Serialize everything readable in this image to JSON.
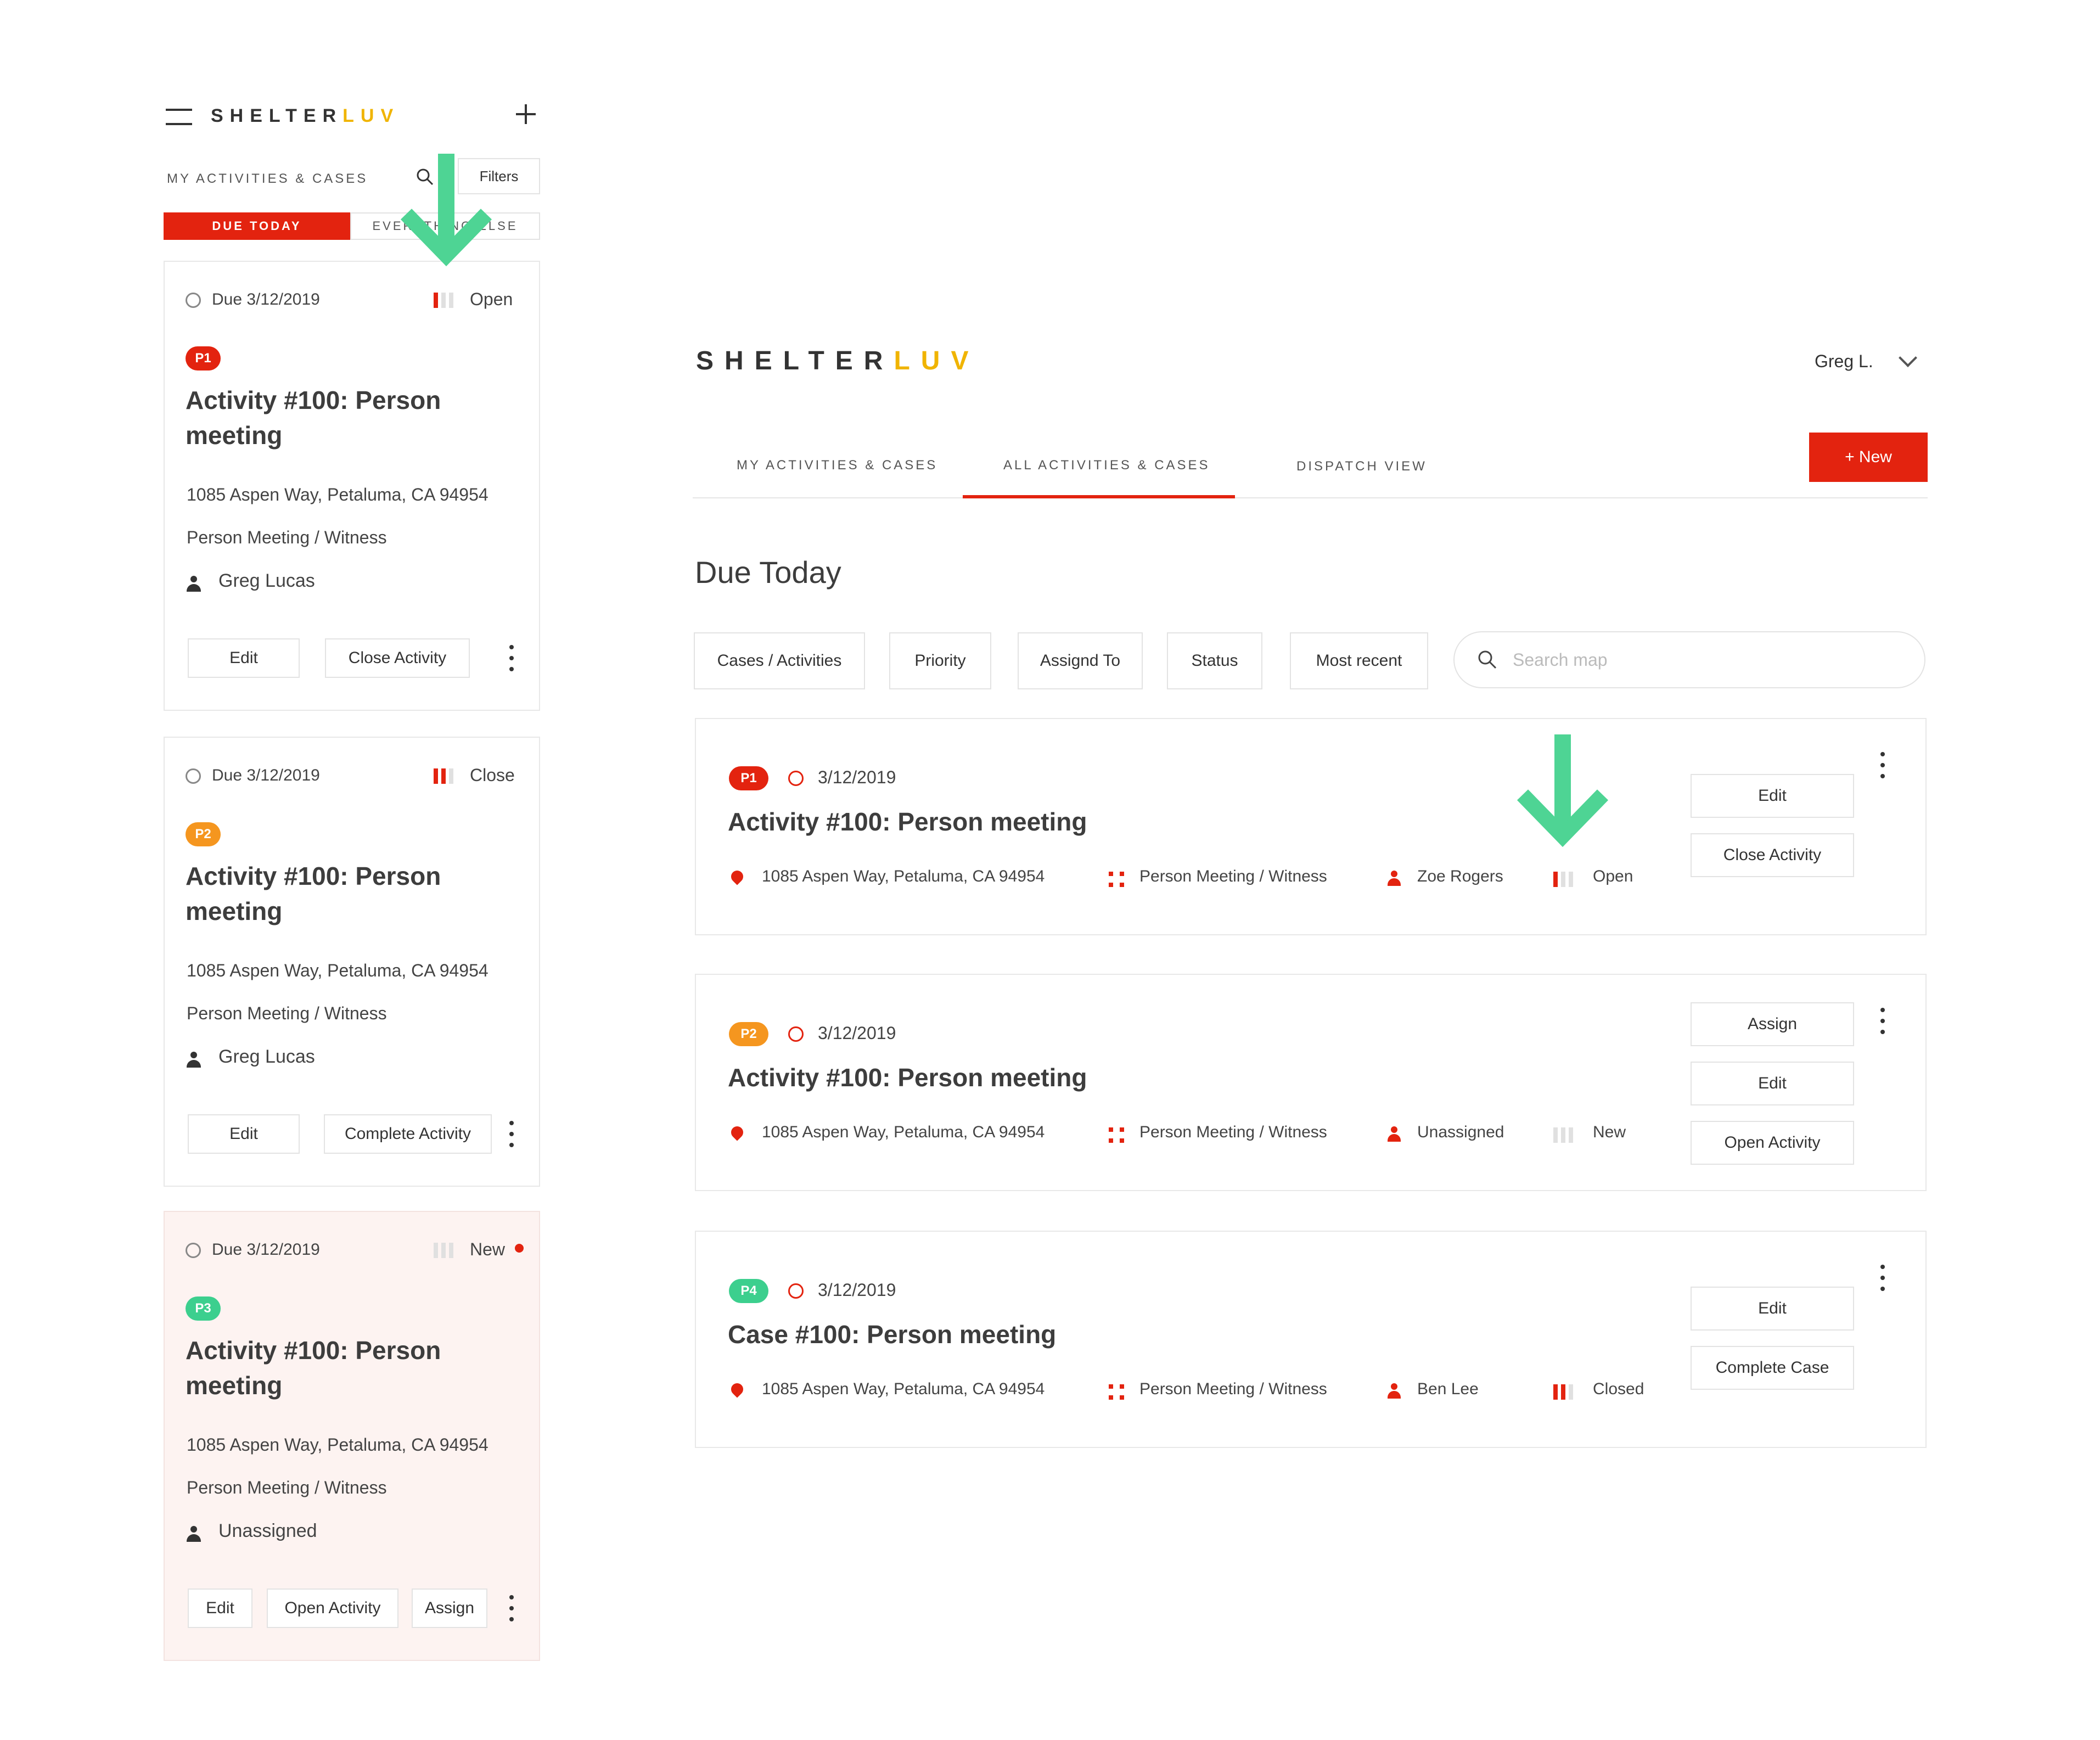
{
  "brand": {
    "part1": "SHELTER",
    "part2": "LUV",
    "accent": "#f0b400"
  },
  "colors": {
    "red": "#e3230f",
    "orange": "#f5961f",
    "green": "#3ccf8e",
    "arrow": "#4ed494",
    "newBg": "#fdf3f1"
  },
  "mobile": {
    "heading": "MY ACTIVITIES & CASES",
    "filters": "Filters",
    "tabs": [
      "DUE TODAY",
      "EVERYTHING ELSE"
    ],
    "cards": [
      {
        "due": "Due 3/12/2019",
        "status": "Open",
        "priority": "P1",
        "title": "Activity #100: Person meeting",
        "address": "1085 Aspen Way, Petaluma, CA 94954",
        "type": "Person Meeting / Witness",
        "person": "Greg Lucas",
        "buttons": [
          "Edit",
          "Close Activity"
        ]
      },
      {
        "due": "Due 3/12/2019",
        "status": "Close",
        "priority": "P2",
        "title": "Activity #100: Person meeting",
        "address": "1085 Aspen Way, Petaluma, CA 94954",
        "type": "Person Meeting / Witness",
        "person": "Greg Lucas",
        "buttons": [
          "Edit",
          "Complete Activity"
        ]
      },
      {
        "due": "Due 3/12/2019",
        "status": "New",
        "priority": "P3",
        "title": "Activity #100: Person meeting",
        "address": "1085 Aspen Way, Petaluma, CA 94954",
        "type": "Person Meeting / Witness",
        "person": "Unassigned",
        "buttons": [
          "Edit",
          "Open Activity",
          "Assign"
        ]
      }
    ]
  },
  "desktop": {
    "user": "Greg L.",
    "tabs": [
      "MY ACTIVITIES & CASES",
      "ALL ACTIVITIES & CASES",
      "DISPATCH VIEW"
    ],
    "new_button": "+ New",
    "heading": "Due Today",
    "filters": [
      "Cases / Activities",
      "Priority",
      "Assignd To",
      "Status",
      "Most recent"
    ],
    "search_placeholder": "Search map",
    "items": [
      {
        "priority": "P1",
        "date": "3/12/2019",
        "title": "Activity #100: Person meeting",
        "address": "1085 Aspen Way, Petaluma, CA 94954",
        "type": "Person Meeting / Witness",
        "person": "Zoe Rogers",
        "status": "Open",
        "buttons": [
          "Edit",
          "Close Activity"
        ]
      },
      {
        "priority": "P2",
        "date": "3/12/2019",
        "title": "Activity #100: Person meeting",
        "address": "1085 Aspen Way, Petaluma, CA 94954",
        "type": "Person Meeting / Witness",
        "person": "Unassigned",
        "status": "New",
        "buttons": [
          "Assign",
          "Edit",
          "Open Activity"
        ]
      },
      {
        "priority": "P4",
        "date": "3/12/2019",
        "title": "Case #100: Person meeting",
        "address": "1085 Aspen Way, Petaluma, CA 94954",
        "type": "Person Meeting / Witness",
        "person": "Ben Lee",
        "status": "Closed",
        "buttons": [
          "Edit",
          "Complete Case"
        ]
      }
    ]
  }
}
